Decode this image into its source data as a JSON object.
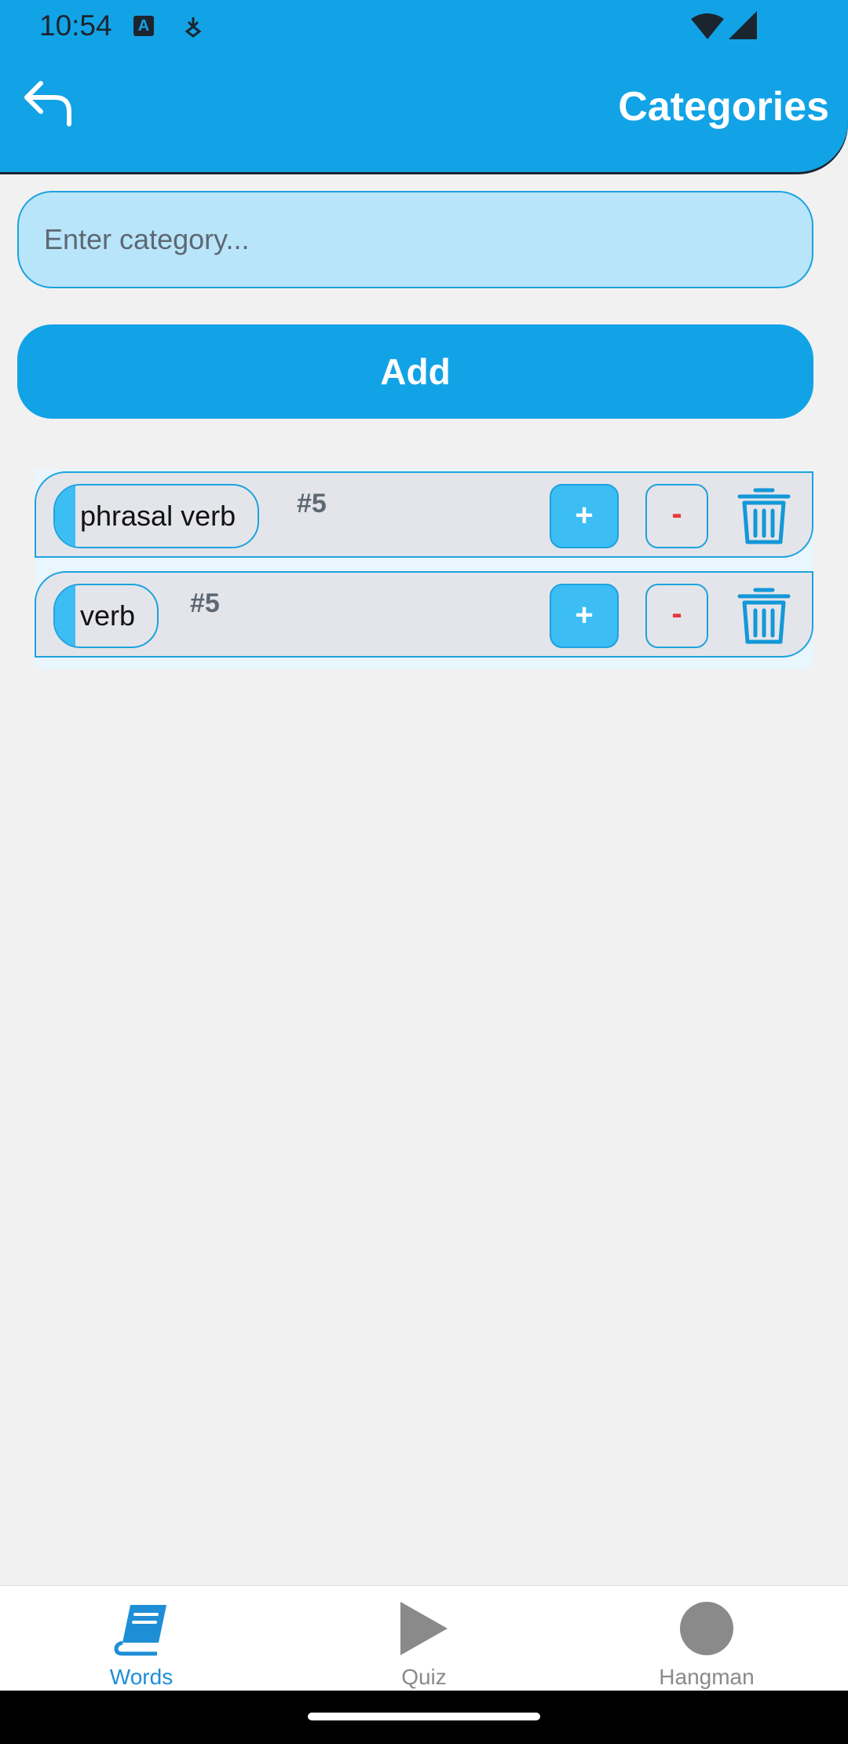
{
  "status_bar": {
    "time": "10:54"
  },
  "header": {
    "title": "Categories"
  },
  "form": {
    "input_value": "",
    "input_placeholder": "Enter category...",
    "add_label": "Add"
  },
  "categories": [
    {
      "name": "phrasal verb",
      "count": "#5",
      "plus": "+",
      "minus": "-"
    },
    {
      "name": "verb",
      "count": "#5",
      "plus": "+",
      "minus": "-"
    }
  ],
  "bottom_nav": [
    {
      "label": "Words",
      "icon": "book-icon",
      "active": true
    },
    {
      "label": "Quiz",
      "icon": "play-icon",
      "active": false
    },
    {
      "label": "Hangman",
      "icon": "circle-icon",
      "active": false
    }
  ],
  "colors": {
    "primary": "#12a3e6",
    "input_bg": "#b9e5fa",
    "row_bg": "#e4e5ea",
    "minus": "#e43b3b",
    "nav_active": "#1e8fd6",
    "nav_inactive": "#8a8a8a"
  }
}
